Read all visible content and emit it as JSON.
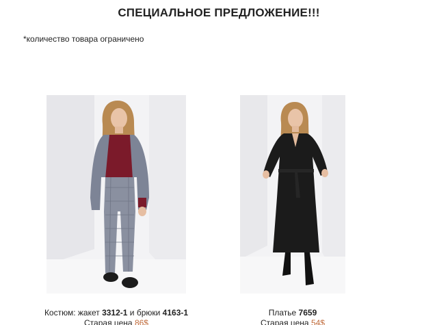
{
  "header": {
    "title": "СПЕЦИАЛЬНОЕ ПРЕДЛОЖЕНИЕ!!!",
    "note": "*количество товара ограничено"
  },
  "products": [
    {
      "name_prefix": "Костюм: жакет ",
      "code_1": "3312-1",
      "name_mid": " и брюки ",
      "code_2": "4163-1",
      "price_label": "Старая цена ",
      "price_value": "86$"
    },
    {
      "name_prefix": "Платье ",
      "code_1": "7659",
      "price_label": "Старая цена ",
      "price_value": "54$"
    }
  ],
  "colors": {
    "text": "#222222",
    "price_accent": "#c06a3a",
    "studio_bg": "#f1f1f3"
  },
  "icons": {
    "photo_1": "model-in-plaid-suit-photo",
    "photo_2": "model-in-black-dress-photo"
  }
}
